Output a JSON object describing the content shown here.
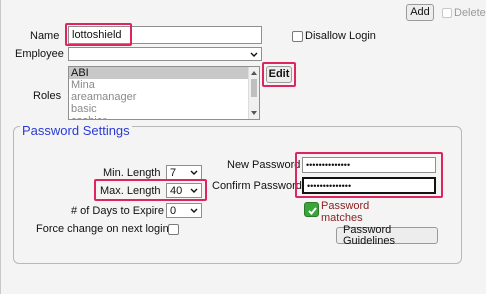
{
  "toolbar": {
    "add_label": "Add",
    "delete_label": "Delete"
  },
  "form": {
    "name_label": "Name",
    "name_value": "lottoshield",
    "disallow_login_label": "Disallow Login",
    "employee_label": "Employee",
    "employee_value": "",
    "roles_label": "Roles",
    "roles": [
      "ABI",
      "Mina",
      "areamanager",
      "basic",
      "cashier"
    ],
    "edit_label": "Edit"
  },
  "password_settings": {
    "legend": "Password Settings",
    "min_length_label": "Min. Length",
    "min_length_value": "7",
    "max_length_label": "Max. Length",
    "max_length_value": "40",
    "days_to_expire_label": "# of Days to Expire",
    "days_to_expire_value": "0",
    "force_change_label": "Force change on next login",
    "new_password_label": "New Password",
    "new_password_value": "••••••••••••••",
    "confirm_password_label": "Confirm Password",
    "confirm_password_value": "••••••••••••••",
    "match_status_line1": "Password",
    "match_status_line2": "matches",
    "guidelines_label": "Password Guidelines"
  },
  "colors": {
    "highlight": "#e0245e",
    "legend": "#2a3bd6",
    "match_ok": "#3aa63a",
    "match_text": "#8b1f1f"
  }
}
